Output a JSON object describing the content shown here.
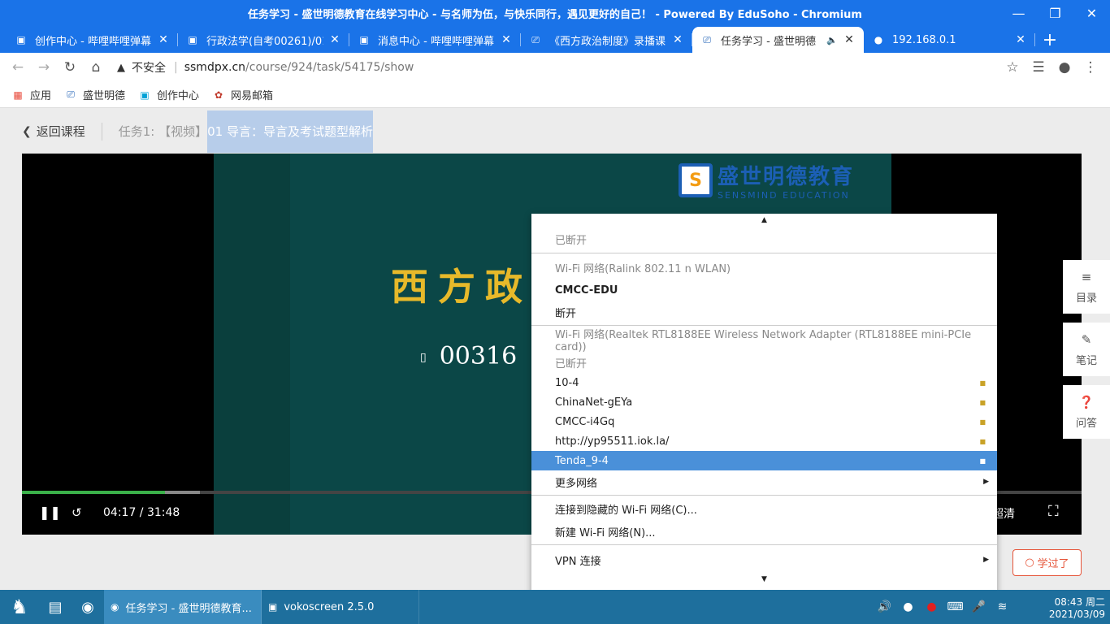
{
  "window": {
    "title": "任务学习 - 盛世明德教育在线学习中心 - 与名师为伍，与快乐同行，遇见更好的自己！ - Powered By EduSoho - Chromium",
    "min_icon": "minimize-icon",
    "max_icon": "restore-icon",
    "close_icon": "close-icon"
  },
  "tabs": [
    {
      "title": "创作中心 - 哔哩哔哩弹幕",
      "icon": "bilibili-icon"
    },
    {
      "title": "行政法学(自考00261)/01",
      "icon": "bilibili-icon"
    },
    {
      "title": "消息中心 - 哔哩哔哩弹幕",
      "icon": "bilibili-icon"
    },
    {
      "title": "《西方政治制度》录播课",
      "icon": "ssmd-icon"
    },
    {
      "title": "任务学习 - 盛世明德",
      "icon": "ssmd-icon",
      "active": true
    },
    {
      "title": "192.168.0.1",
      "icon": "globe-icon"
    }
  ],
  "address": {
    "insecure_label": "不安全",
    "host": "ssmdpx.cn",
    "path": "/course/924/task/54175/show"
  },
  "bookmarks": [
    {
      "label": "应用",
      "icon": "apps-grid-icon"
    },
    {
      "label": "盛世明德",
      "icon": "ssmd-icon"
    },
    {
      "label": "创作中心",
      "icon": "bilibili-icon"
    },
    {
      "label": "网易邮箱",
      "icon": "netease-mail-icon"
    }
  ],
  "page": {
    "back_label": "返回课程",
    "task_prefix": "任务1: 【视频】",
    "task_title": "01 导言：导言及考试题型解析",
    "learned_label": "学过了"
  },
  "video": {
    "logo_cn": "盛世明德教育",
    "logo_en": "SENSMIND EDUCATION",
    "slide_title": "西方政",
    "slide_code": "00316",
    "current_time": "04:17",
    "total_time": "31:48",
    "progress_fraction": 0.135,
    "buffered_fraction": 0.168,
    "quality_label": "超清",
    "accent": "#3bb14a"
  },
  "side_tools": [
    {
      "label": "目录",
      "icon": "list-icon"
    },
    {
      "label": "笔记",
      "icon": "pencil-icon"
    },
    {
      "label": "问答",
      "icon": "question-icon"
    }
  ],
  "network_menu": {
    "status1": "已断开",
    "wifi1_header": "Wi-Fi 网络(Ralink 802.11 n WLAN)",
    "wifi1_connected": "CMCC-EDU",
    "wifi1_disconnect": "断开",
    "wifi2_header": "Wi-Fi 网络(Realtek RTL8188EE Wireless Network Adapter (RTL8188EE mini-PCIe card))",
    "status2": "已断开",
    "networks": [
      "10-4",
      "ChinaNet-gEYa",
      "CMCC-i4Gq",
      "http://yp95511.iok.la/",
      "Tenda_9-4"
    ],
    "selected_network": "Tenda_9-4",
    "more_networks": "更多网络",
    "connect_hidden": "连接到隐藏的 Wi-Fi 网络(C)...",
    "new_wifi": "新建 Wi-Fi 网络(N)...",
    "vpn": "VPN 连接"
  },
  "taskbar": {
    "tasks": [
      {
        "label": "任务学习 - 盛世明德教育...",
        "icon": "chromium-icon"
      },
      {
        "label": "vokoscreen 2.5.0",
        "icon": "vokoscreen-icon"
      }
    ],
    "time": "08:43 周二",
    "date": "2021/03/09"
  }
}
